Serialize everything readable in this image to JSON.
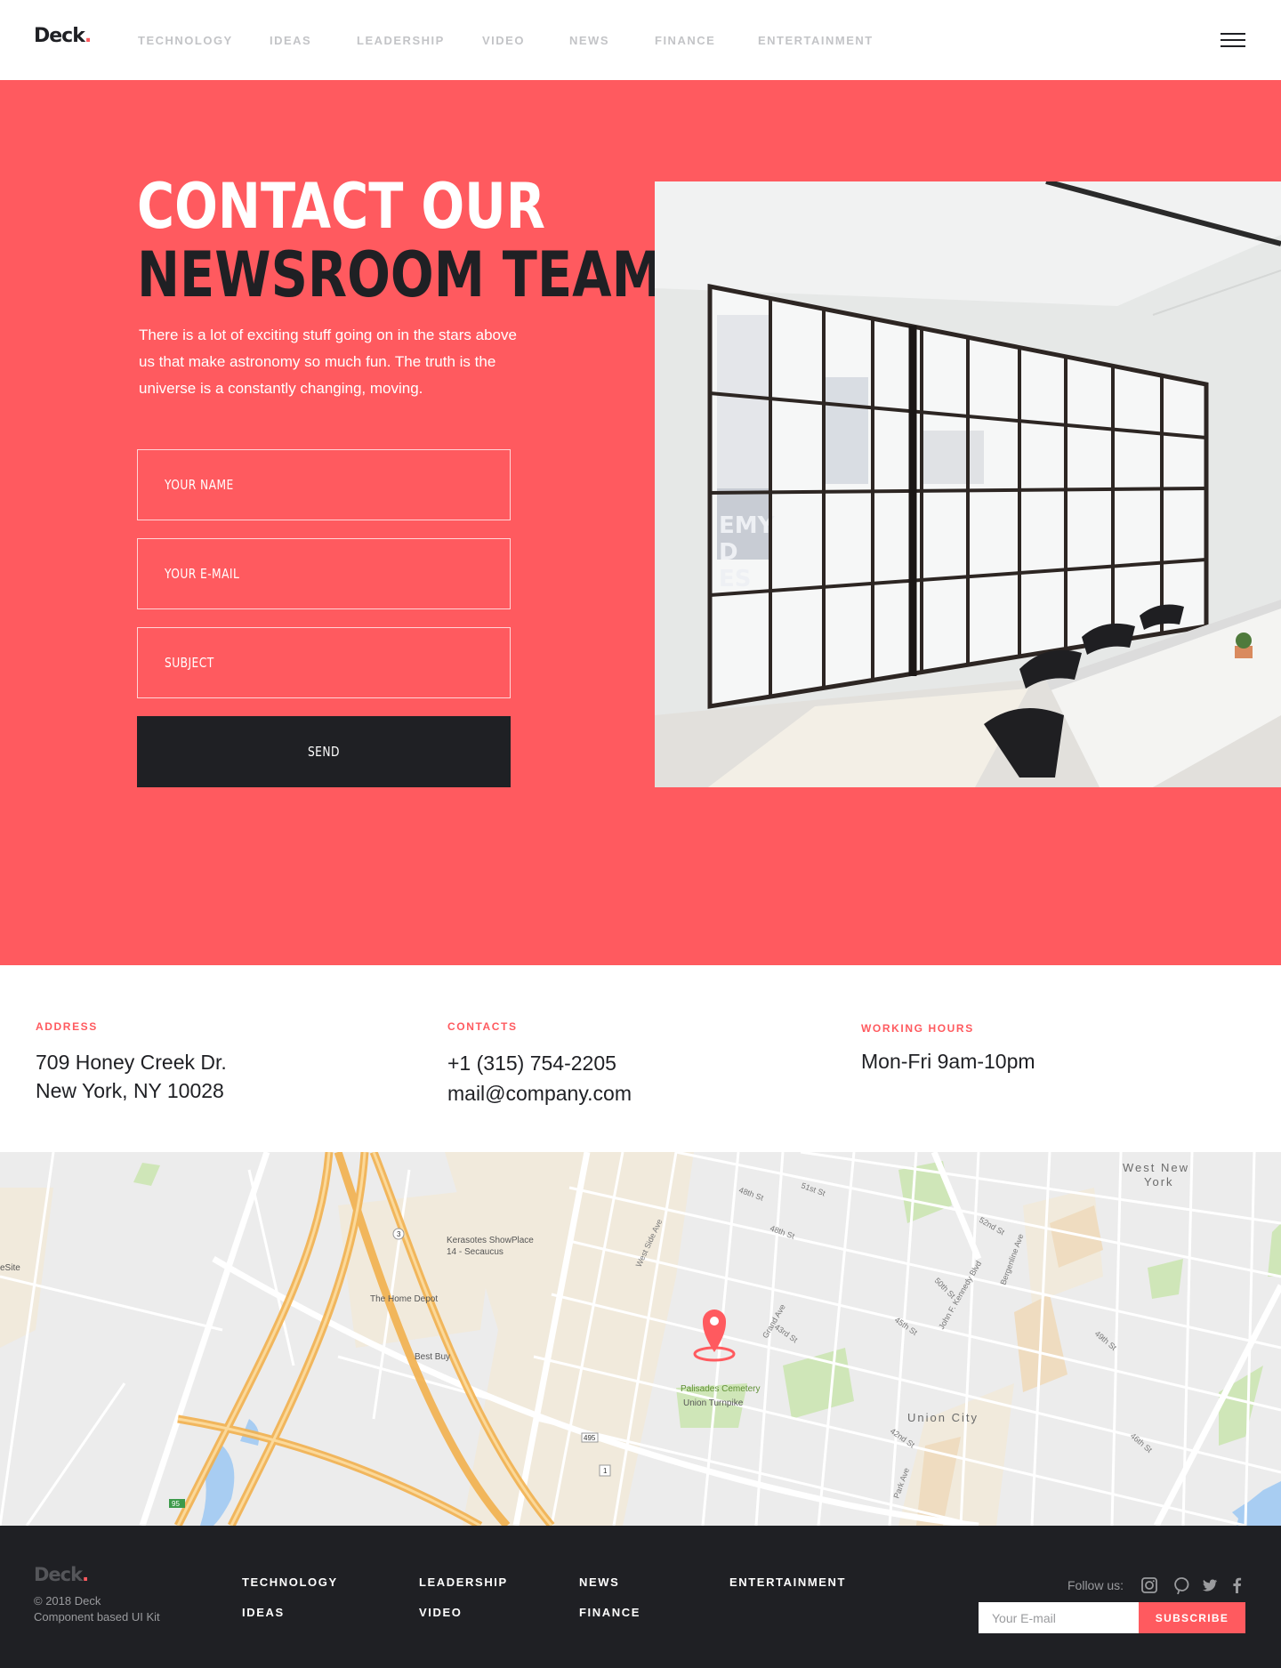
{
  "header": {
    "logo": "Deck",
    "logo_dot": ".",
    "nav": [
      {
        "label": "TECHNOLOGY"
      },
      {
        "label": "IDEAS"
      },
      {
        "label": "LEADERSHIP"
      },
      {
        "label": "VIDEO"
      },
      {
        "label": "NEWS"
      },
      {
        "label": "FINANCE"
      },
      {
        "label": "ENTERTAINMENT"
      }
    ],
    "menu_icon": "hamburger-icon"
  },
  "hero": {
    "title_line1": "CONTACT OUR",
    "title_line2": "NEWSROOM TEAM",
    "description": "There is a lot of exciting stuff going on in the stars above us that make astronomy so much fun. The truth is the universe is a constantly changing, moving.",
    "form": {
      "name_placeholder": "YOUR NAME",
      "email_placeholder": "YOUR E-MAIL",
      "subject_placeholder": "SUBJECT",
      "send_label": "SEND"
    },
    "image_alt": "Meeting room with large industrial windows"
  },
  "info": {
    "address": {
      "label": "ADDRESS",
      "line1": "709 Honey Creek Dr.",
      "line2": "New York, NY 10028"
    },
    "contacts": {
      "label": "CONTACTS",
      "phone": "+1 (315) 754-2205",
      "email": "mail@company.com"
    },
    "hours": {
      "label": "WORKING HOURS",
      "value": "Mon-Fri 9am-10pm"
    }
  },
  "map": {
    "labels": {
      "west_new_york_1": "West New",
      "west_new_york_2": "York",
      "union_city": "Union City",
      "kerasotes_1": "Kerasotes ShowPlace",
      "kerasotes_2": "14 - Secaucus",
      "home_depot": "The Home Depot",
      "best_buy": "Best Buy",
      "palisades": "Palisades Cemetery",
      "site": "eSite",
      "union_tpke": "Union Turnpike",
      "st_48": "48th St",
      "st_49": "49th St",
      "st_50": "50th St",
      "st_51": "51st St",
      "st_52": "52nd St",
      "st_43": "43rd St",
      "st_45": "45th St",
      "st_46": "46th St",
      "st_42": "42nd St",
      "kennedy": "John F. Kennedy Blvd",
      "bergenline": "Bergenline Ave",
      "park_ave": "Park Ave",
      "west_side": "West Side Ave",
      "grand_ave": "Grand Ave",
      "hwy_3": "3",
      "hwy_495": "495",
      "hwy_1": "1",
      "hwy_95": "95"
    },
    "marker_icon": "map-pin-icon"
  },
  "footer": {
    "logo": "Deck",
    "logo_dot": ".",
    "copyright": "© 2018 Deck",
    "tagline": "Component based UI Kit",
    "links": [
      {
        "label": "TECHNOLOGY"
      },
      {
        "label": "IDEAS"
      },
      {
        "label": "LEADERSHIP"
      },
      {
        "label": "VIDEO"
      },
      {
        "label": "NEWS"
      },
      {
        "label": "FINANCE"
      },
      {
        "label": "ENTERTAINMENT"
      }
    ],
    "follow_label": "Follow us:",
    "social": [
      {
        "icon": "instagram-icon"
      },
      {
        "icon": "pinterest-icon"
      },
      {
        "icon": "twitter-icon"
      },
      {
        "icon": "facebook-icon"
      }
    ],
    "email_placeholder": "Your E-mail",
    "subscribe_label": "SUBSCRIBE"
  },
  "colors": {
    "accent": "#ff5a5f",
    "dark": "#1f2024",
    "nav_inactive": "#c3c4c7",
    "map_bg": "#ececec",
    "road_major": "#f6c66b"
  }
}
